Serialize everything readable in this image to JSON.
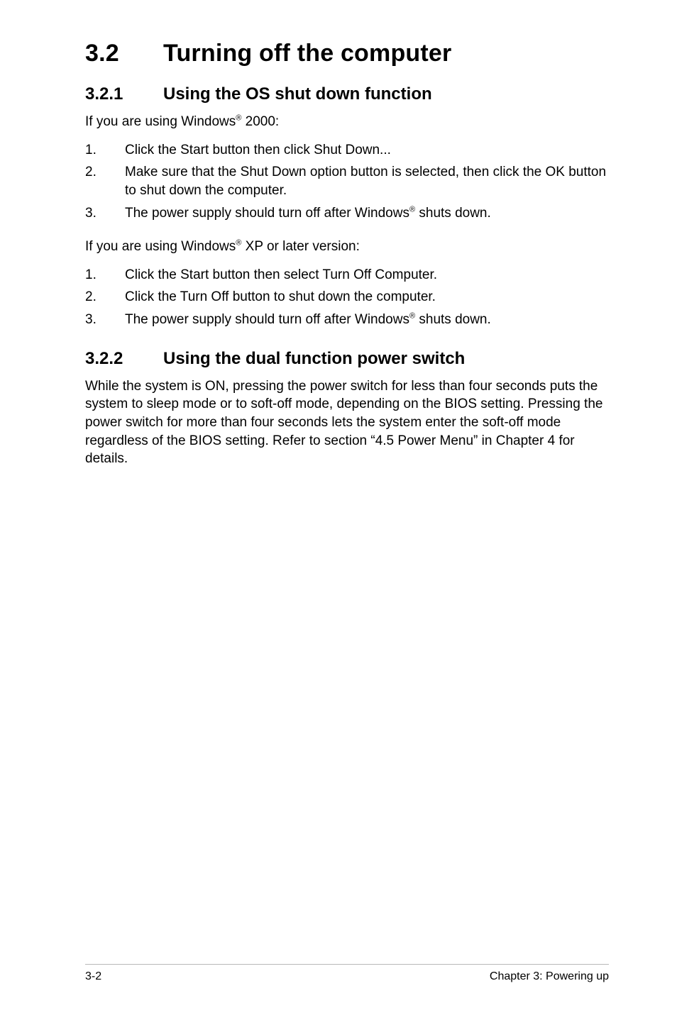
{
  "h1": {
    "num": "3.2",
    "title": "Turning off the computer"
  },
  "s1": {
    "h2": {
      "num": "3.2.1",
      "title": "Using the OS shut down function"
    },
    "intro_pre": "If you are using Windows",
    "intro_post": " 2000:",
    "items": [
      "Click the Start button then click Shut Down...",
      "Make sure that the Shut Down option button is selected, then click the OK button to shut down the computer.",
      {
        "pre": "The power supply should turn off after Windows",
        "post": " shuts down."
      }
    ],
    "intro2_pre": "If you are using Windows",
    "intro2_post": " XP or later version:",
    "items2": [
      "Click the Start button then select Turn Off Computer.",
      "Click the Turn Off button to shut down the computer.",
      {
        "pre": "The power supply should turn off after Windows",
        "post": " shuts down."
      }
    ]
  },
  "s2": {
    "h2": {
      "num": "3.2.2",
      "title": "Using the dual function power switch"
    },
    "para": "While the system is ON, pressing the power switch for less than four seconds puts the system to sleep mode or to soft-off mode, depending on the BIOS setting. Pressing the power switch for more than four seconds lets the system enter the soft-off mode regardless of the BIOS setting. Refer to section  “4.5  Power Menu” in Chapter 4 for details."
  },
  "footer": {
    "left": "3-2",
    "right": "Chapter 3: Powering up"
  },
  "reg": "®",
  "markers": {
    "m1": "1.",
    "m2": "2.",
    "m3": "3."
  }
}
